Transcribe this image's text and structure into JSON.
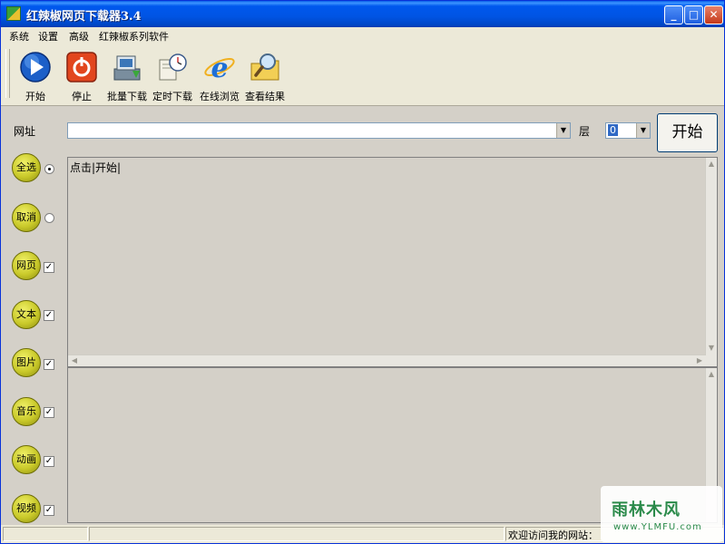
{
  "window": {
    "title": "红辣椒网页下载器3.4",
    "minimize": "_",
    "maximize": "□",
    "close": "✕"
  },
  "menu": [
    "系统",
    "设置",
    "高级",
    "红辣椒系列软件"
  ],
  "toolbar": [
    {
      "label": "开始",
      "icon": "play-icon"
    },
    {
      "label": "停止",
      "icon": "power-stop-icon"
    },
    {
      "label": "批量下载",
      "icon": "batch-download-icon"
    },
    {
      "label": "定时下载",
      "icon": "timer-download-icon"
    },
    {
      "label": "在线浏览",
      "icon": "ie-browser-icon"
    },
    {
      "label": "查看结果",
      "icon": "magnifier-folder-icon"
    }
  ],
  "form": {
    "url_label": "网址",
    "url_value": "",
    "layer_label": "层",
    "layer_value": "0",
    "start_button": "开始"
  },
  "log_text": "点击|开始|",
  "side": [
    {
      "label": "全选",
      "control": "radio",
      "checked": true
    },
    {
      "label": "取消",
      "control": "radio",
      "checked": false
    },
    {
      "label": "网页",
      "control": "checkbox",
      "checked": true
    },
    {
      "label": "文本",
      "control": "checkbox",
      "checked": true
    },
    {
      "label": "图片",
      "control": "checkbox",
      "checked": true
    },
    {
      "label": "音乐",
      "control": "checkbox",
      "checked": true
    },
    {
      "label": "动画",
      "control": "checkbox",
      "checked": true
    },
    {
      "label": "视频",
      "control": "checkbox",
      "checked": true
    }
  ],
  "status": {
    "text": "欢迎访问我的网站："
  },
  "watermark": {
    "title": "雨林木风",
    "sub": "www.YLMFU.com"
  },
  "colors": {
    "titlebar": "#0054e3",
    "accent_green": "#2a8a4a",
    "side_button": "#c9c92a"
  }
}
